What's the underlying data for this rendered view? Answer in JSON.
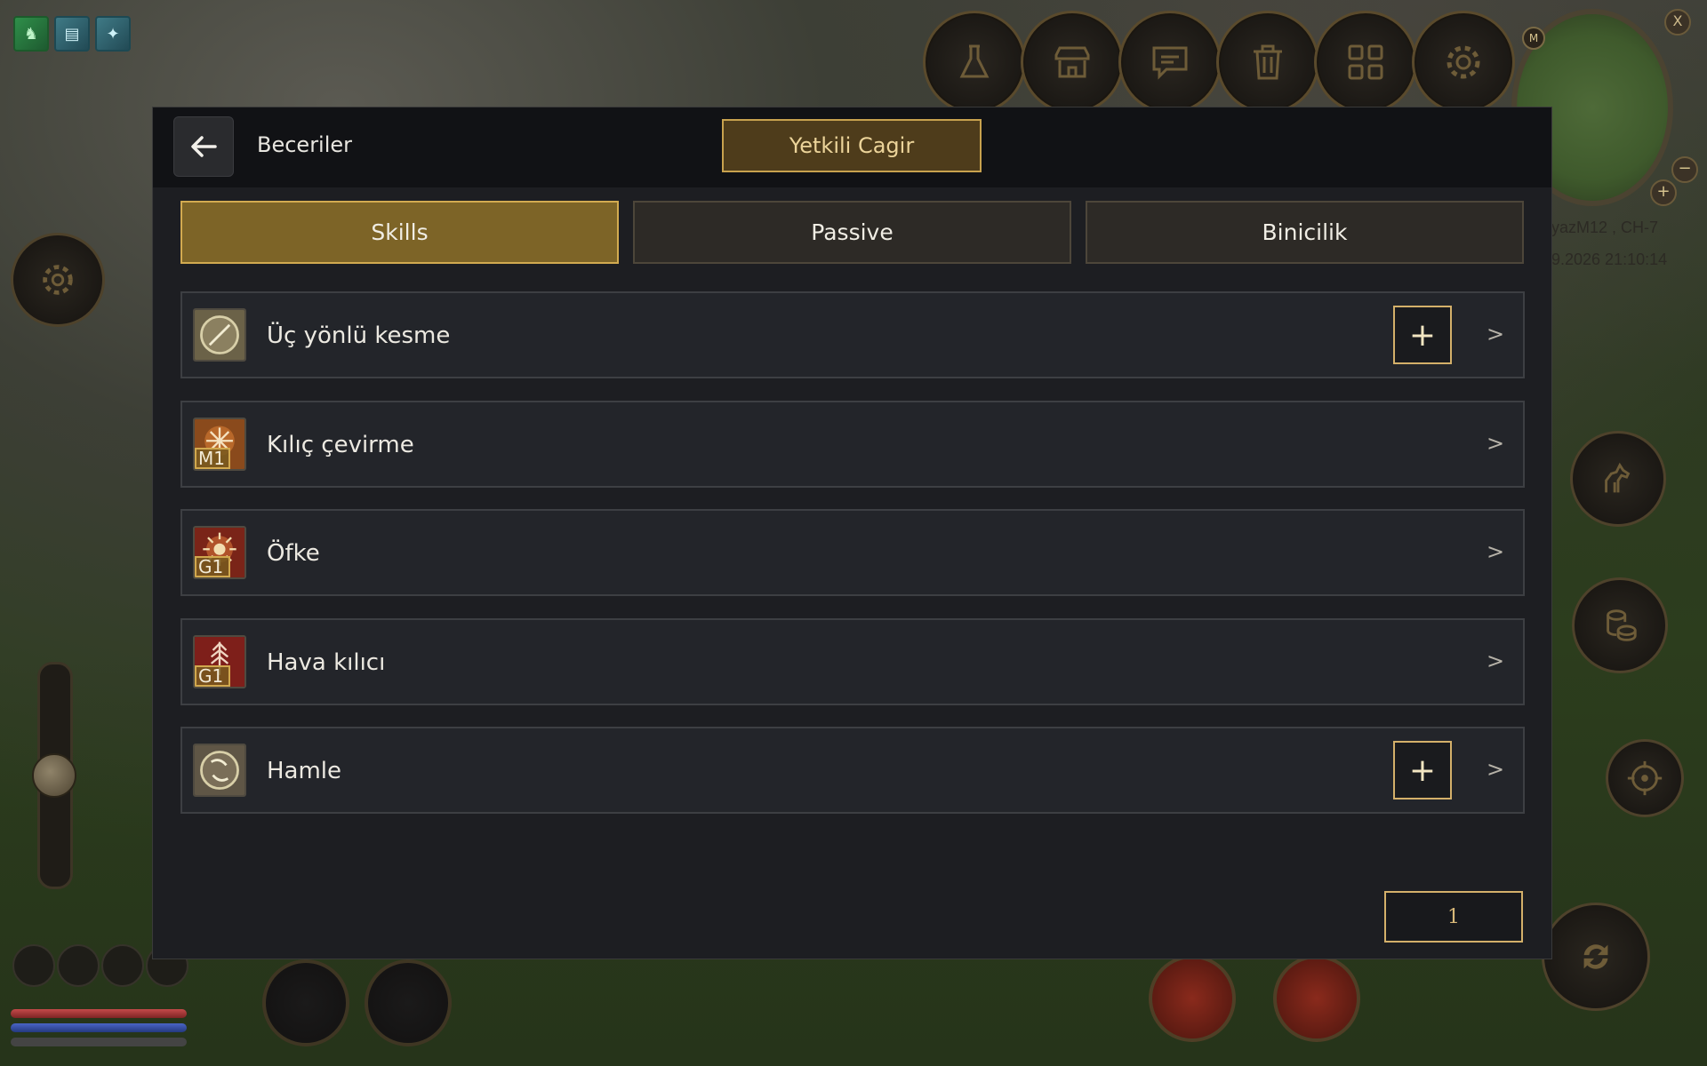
{
  "modal": {
    "title": "Beceriler",
    "call_button": "Yetkili Cagir",
    "tabs": [
      {
        "label": "Skills",
        "active": true
      },
      {
        "label": "Passive",
        "active": false
      },
      {
        "label": "Binicilik",
        "active": false
      }
    ],
    "skills": [
      {
        "name": "Üç yönlü kesme",
        "grade": "",
        "has_plus": true,
        "icon": "blade-slash-icon"
      },
      {
        "name": "Kılıç çevirme",
        "grade": "M1",
        "has_plus": false,
        "icon": "sword-spin-icon"
      },
      {
        "name": "Öfke",
        "grade": "G1",
        "has_plus": false,
        "icon": "rage-icon"
      },
      {
        "name": "Hava kılıcı",
        "grade": "G1",
        "has_plus": false,
        "icon": "air-sword-icon"
      },
      {
        "name": "Hamle",
        "grade": "",
        "has_plus": true,
        "icon": "dash-icon"
      }
    ],
    "plus_label": "+",
    "chevron_label": ">",
    "page": "1"
  },
  "hud": {
    "server": "yazM12 , CH-7",
    "datetime": "9.2026 21:10:14",
    "minimap_letter": "M",
    "minimap_close": "X",
    "zoom_in": "+",
    "zoom_out": "−",
    "top_buttons": [
      "flask-icon",
      "shop-icon",
      "chat-icon",
      "trash-icon",
      "grid-icon",
      "gear-icon"
    ]
  },
  "colors": {
    "accent_gold": "#d2aa50",
    "tab_active": "#7d6427",
    "panel_bg": "#1d1e22"
  }
}
